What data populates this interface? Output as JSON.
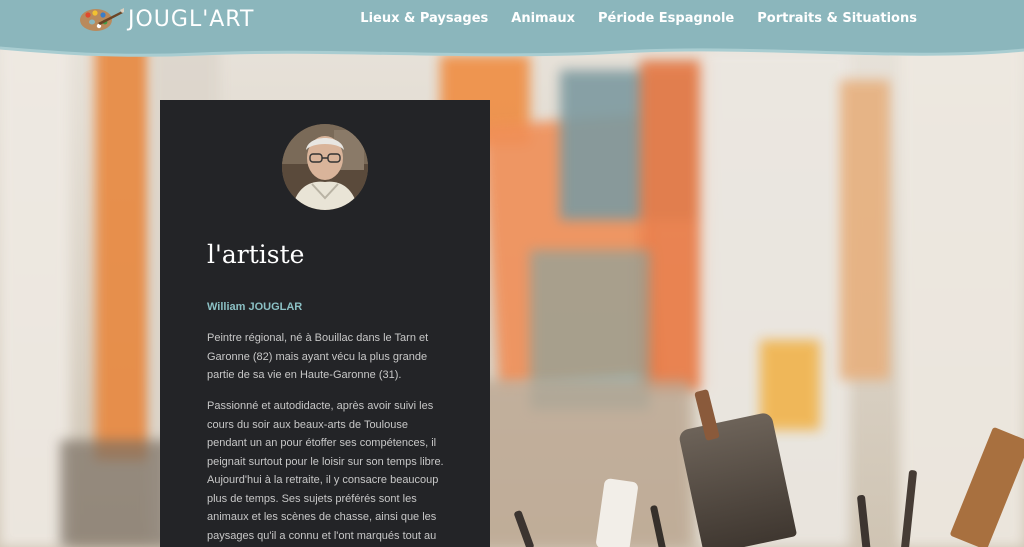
{
  "header": {
    "logo_text": "JOUGL'ART",
    "logo_icon": "palette-icon",
    "nav": [
      {
        "label": "Lieux & Paysages"
      },
      {
        "label": "Animaux"
      },
      {
        "label": "Période Espagnole"
      },
      {
        "label": "Portraits & Situations"
      }
    ]
  },
  "card": {
    "title": "l'artiste",
    "name": "William JOUGLAR",
    "paragraphs": [
      "Peintre régional, né à Bouillac dans le Tarn et Garonne (82) mais ayant vécu la plus grande partie de sa vie en Haute-Garonne (31).",
      "Passionné et autodidacte, après avoir suivi les cours du soir aux beaux-arts de Toulouse pendant un an pour étoffer ses compétences, il peignait surtout pour le loisir sur son temps libre. Aujourd'hui à la retraite, il y consacre beaucoup plus de temps. Ses sujets préférés sont les animaux et les scènes de chasse, ainsi que les paysages qu'il a connu et l'ont marqués tout au"
    ]
  },
  "colors": {
    "header": "#8bb6bc",
    "card": "#232427",
    "accent": "#8bc0c4"
  }
}
